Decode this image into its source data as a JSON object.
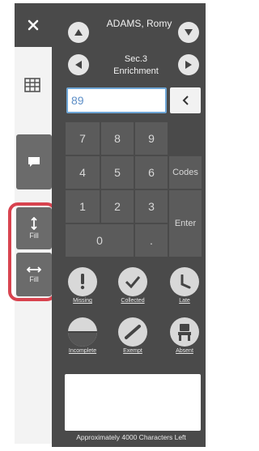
{
  "rail": {
    "fill_vertical_label": "Fill",
    "fill_horizontal_label": "Fill"
  },
  "student": {
    "name": "ADAMS, Romy"
  },
  "section": {
    "line1": "Sec.3",
    "line2": "Enrichment"
  },
  "grade": {
    "value": "89"
  },
  "keypad": {
    "keys": [
      "7",
      "8",
      "9",
      "4",
      "5",
      "6",
      "1",
      "2",
      "3",
      "0",
      "."
    ],
    "codes_label": "Codes",
    "enter_label": "Enter"
  },
  "statuses": [
    {
      "label": "Missing"
    },
    {
      "label": "Collected"
    },
    {
      "label": "Late"
    },
    {
      "label": "Incomplete"
    },
    {
      "label": "Exempt"
    },
    {
      "label": "Absent"
    }
  ],
  "comment": {
    "counter_text": "Approximately 4000 Characters Left"
  },
  "colors": {
    "panel": "#4a4a4a",
    "key": "#5b5b5b",
    "highlight": "#d8434f",
    "accent": "#6ea6d6"
  }
}
